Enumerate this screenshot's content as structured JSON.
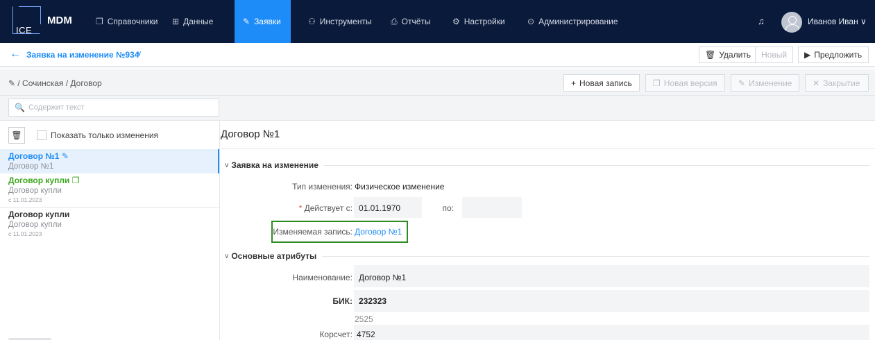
{
  "app": {
    "brand": "MDM",
    "logo_text": "ICE"
  },
  "nav": {
    "items": [
      {
        "label": "Справочники",
        "icon": "bookmark-icon",
        "glyph": "❐"
      },
      {
        "label": "Данные",
        "icon": "grid-icon",
        "glyph": "⊞"
      },
      {
        "label": "Заявки",
        "icon": "edit-icon",
        "glyph": "✎",
        "active": true
      },
      {
        "label": "Инструменты",
        "icon": "users-icon",
        "glyph": "⚇"
      },
      {
        "label": "Отчёты",
        "icon": "printer-icon",
        "glyph": "⎙"
      },
      {
        "label": "Настройки",
        "icon": "gear-icon",
        "glyph": "⚙"
      },
      {
        "label": "Администрирование",
        "icon": "shield-icon",
        "glyph": "⊙"
      }
    ],
    "bell_glyph": "♫",
    "user_name": "Иванов Иван ∨"
  },
  "request": {
    "title": "Заявка на изменение №934",
    "chevron": "∨",
    "actions": {
      "delete": "Удалить",
      "new": "Новый",
      "propose": "Предложить"
    }
  },
  "breadcrumb": {
    "path": "✎ / Сочинская / Договор"
  },
  "record_actions": {
    "new_record": "Новая запись",
    "new_version": "Новая версия",
    "change": "Изменение",
    "close": "Закрытие"
  },
  "search": {
    "placeholder": "Содержит текст"
  },
  "filter": {
    "show_changes_only": "Показать только изменения"
  },
  "tree": [
    {
      "title": "Договор №1",
      "subtitle": "Договор №1",
      "date": "",
      "icon": "pencil-icon"
    },
    {
      "title": "Договор купли",
      "subtitle": "Договор купли",
      "date": "с 11.01.2023",
      "icon": "copy-icon"
    },
    {
      "title": "Договор купли",
      "subtitle": "Договор купли",
      "date": "с 11.01.2023",
      "icon": ""
    }
  ],
  "record": {
    "title": "Договор №1",
    "sections": {
      "request": {
        "title": "Заявка на изменение",
        "change_type_label": "Тип изменения:",
        "change_type_value": "Физическое изменение",
        "valid_from_label": "Действует с:",
        "valid_from_value": "01.01.1970",
        "valid_to_label": "по:",
        "valid_to_value": "",
        "changed_record_label": "Изменяемая запись:",
        "changed_record_value": "Договор №1"
      },
      "main": {
        "title": "Основные атрибуты",
        "name_label": "Наименование:",
        "name_value": "Договор №1",
        "bik_label": "БИК:",
        "bik_value": "232323",
        "bik_secondary": "2525",
        "korr_label": "Корсчет:",
        "korr_value": "4752"
      }
    }
  },
  "colors": {
    "accent": "#1d8cf8",
    "nav_bg": "#0a1a3a",
    "green": "#3aa61c",
    "highlight": "#2e8b23"
  }
}
